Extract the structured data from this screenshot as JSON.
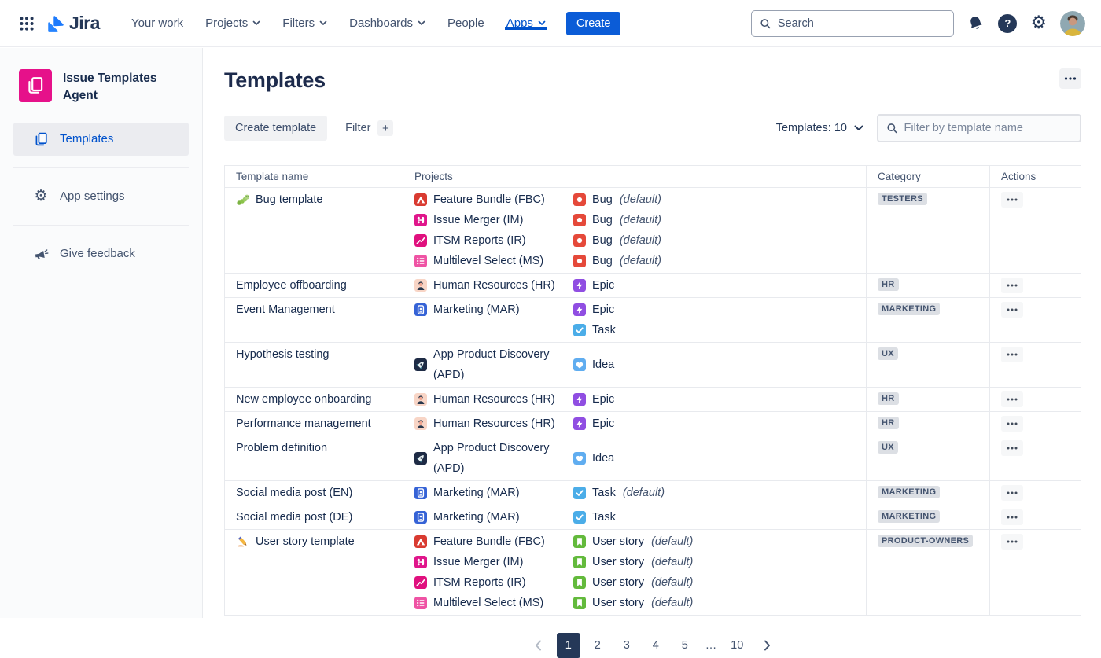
{
  "topnav": {
    "brand": "Jira",
    "items": [
      {
        "label": "Your work",
        "chevron": false,
        "active": false
      },
      {
        "label": "Projects",
        "chevron": true,
        "active": false
      },
      {
        "label": "Filters",
        "chevron": true,
        "active": false
      },
      {
        "label": "Dashboards",
        "chevron": true,
        "active": false
      },
      {
        "label": "People",
        "chevron": false,
        "active": false
      },
      {
        "label": "Apps",
        "chevron": true,
        "active": true
      }
    ],
    "create_label": "Create",
    "search_placeholder": "Search",
    "help_glyph": "?"
  },
  "sidebar": {
    "app_title": "Issue Templates Agent",
    "items": [
      {
        "label": "Templates",
        "icon": "pages-icon",
        "active": true
      },
      {
        "label": "App settings",
        "icon": "gear-icon",
        "active": false
      },
      {
        "label": "Give feedback",
        "icon": "megaphone-icon",
        "active": false
      }
    ]
  },
  "main": {
    "title": "Templates",
    "toolbar": {
      "create_button": "Create template",
      "filter_label": "Filter",
      "add_filter": "+",
      "count_label": "Templates: 10",
      "filter_placeholder": "Filter by template name"
    },
    "table": {
      "columns": [
        "Template name",
        "Projects",
        "Category",
        "Actions"
      ],
      "default_suffix": "(default)",
      "rows": [
        {
          "icon": "caterpillar-emoji",
          "name": "Bug template",
          "category": "TESTERS",
          "entries": [
            {
              "project": "Feature Bundle (FBC)",
              "picon": "fbc",
              "type": "Bug",
              "ticon": "bug",
              "default": true
            },
            {
              "project": "Issue Merger (IM)",
              "picon": "im",
              "type": "Bug",
              "ticon": "bug",
              "default": true
            },
            {
              "project": "ITSM Reports (IR)",
              "picon": "ir",
              "type": "Bug",
              "ticon": "bug",
              "default": true
            },
            {
              "project": "Multilevel Select (MS)",
              "picon": "ms",
              "type": "Bug",
              "ticon": "bug",
              "default": true
            }
          ]
        },
        {
          "icon": null,
          "name": "Employee offboarding",
          "category": "HR",
          "entries": [
            {
              "project": "Human Resources (HR)",
              "picon": "hr",
              "type": "Epic",
              "ticon": "epic",
              "default": false
            }
          ]
        },
        {
          "icon": null,
          "name": "Event Management",
          "category": "MARKETING",
          "entries": [
            {
              "project": "Marketing (MAR)",
              "picon": "mar",
              "type": "Epic",
              "ticon": "epic",
              "default": false
            },
            {
              "project": null,
              "picon": null,
              "type": "Task",
              "ticon": "task",
              "default": false
            }
          ]
        },
        {
          "icon": null,
          "name": "Hypothesis testing",
          "category": "UX",
          "entries": [
            {
              "project": "App Product Discovery (APD)",
              "picon": "apd",
              "type": "Idea",
              "ticon": "idea",
              "default": false
            }
          ]
        },
        {
          "icon": null,
          "name": "New employee onboarding",
          "category": "HR",
          "entries": [
            {
              "project": "Human Resources (HR)",
              "picon": "hr",
              "type": "Epic",
              "ticon": "epic",
              "default": false
            }
          ]
        },
        {
          "icon": null,
          "name": "Performance management",
          "category": "HR",
          "entries": [
            {
              "project": "Human Resources (HR)",
              "picon": "hr",
              "type": "Epic",
              "ticon": "epic",
              "default": false
            }
          ]
        },
        {
          "icon": null,
          "name": "Problem definition",
          "category": "UX",
          "entries": [
            {
              "project": "App Product Discovery (APD)",
              "picon": "apd",
              "type": "Idea",
              "ticon": "idea",
              "default": false
            }
          ]
        },
        {
          "icon": null,
          "name": "Social media post (EN)",
          "category": "MARKETING",
          "entries": [
            {
              "project": "Marketing (MAR)",
              "picon": "mar",
              "type": "Task",
              "ticon": "task",
              "default": true
            }
          ]
        },
        {
          "icon": null,
          "name": "Social media post (DE)",
          "category": "MARKETING",
          "entries": [
            {
              "project": "Marketing (MAR)",
              "picon": "mar",
              "type": "Task",
              "ticon": "task",
              "default": false
            }
          ]
        },
        {
          "icon": "writing-hand-emoji",
          "name": "User story template",
          "category": "PRODUCT-OWNERS",
          "entries": [
            {
              "project": "Feature Bundle (FBC)",
              "picon": "fbc",
              "type": "User story",
              "ticon": "story",
              "default": true
            },
            {
              "project": "Issue Merger (IM)",
              "picon": "im",
              "type": "User story",
              "ticon": "story",
              "default": true
            },
            {
              "project": "ITSM Reports (IR)",
              "picon": "ir",
              "type": "User story",
              "ticon": "story",
              "default": true
            },
            {
              "project": "Multilevel Select (MS)",
              "picon": "ms",
              "type": "User story",
              "ticon": "story",
              "default": true
            }
          ]
        }
      ]
    },
    "pagination": {
      "pages": [
        "1",
        "2",
        "3",
        "4",
        "5",
        "…",
        "10"
      ],
      "current": "1"
    }
  },
  "colors": {
    "accent_blue": "#0052CC",
    "create_blue": "#0B5CD7",
    "brand_pink": "#E6118A",
    "badge_bg": "#DCDFE4",
    "issue_bug": "#E5493A",
    "issue_epic": "#904EE2",
    "issue_task": "#4BADE8",
    "issue_idea": "#60ADF0",
    "issue_story": "#63BA3C",
    "project_fbc": "#D93B31",
    "project_im": "#E0168B",
    "project_ir": "#E0107E",
    "project_ms": "#EF53A4",
    "project_hr": "#F8D5C6",
    "project_mar": "#3663D6",
    "project_apd": "#1E2B45"
  }
}
